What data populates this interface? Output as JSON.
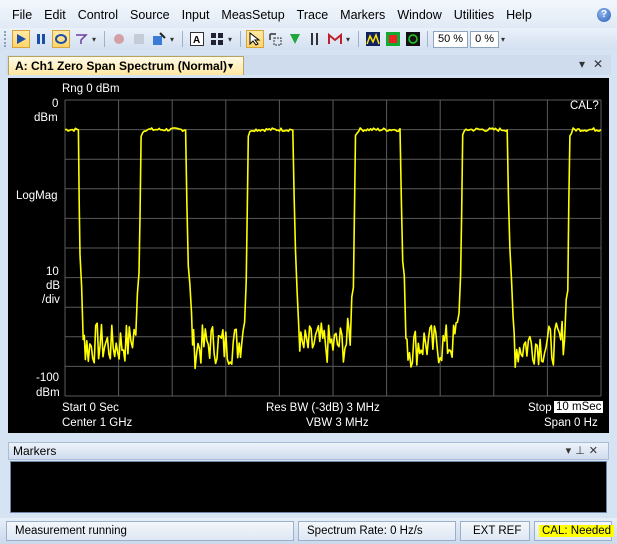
{
  "menu": [
    "File",
    "Edit",
    "Control",
    "Source",
    "Input",
    "MeasSetup",
    "Trace",
    "Markers",
    "Window",
    "Utilities",
    "Help"
  ],
  "toolbar": {
    "zoom_pct": "50 %",
    "pct2": "0 %"
  },
  "document_tab": {
    "title": "A: Ch1 Zero Span Spectrum (Normal)"
  },
  "display": {
    "range_label": "Rng 0 dBm",
    "cal_flag": "CAL?",
    "y_top_value": "0",
    "y_top_unit": "dBm",
    "y_mode": "LogMag",
    "y_div_value": "10",
    "y_div_unit1": "dB",
    "y_div_unit2": "/div",
    "y_bottom_value": "-100",
    "y_bottom_unit": "dBm",
    "start": "Start 0  Sec",
    "center": "Center 1 GHz",
    "res_bw": "Res BW (-3dB) 3 MHz",
    "vbw": "VBW 3 MHz",
    "stop_label": "Stop",
    "stop_value": "10 mSec",
    "span": "Span 0  Hz",
    "trace_color": "#ffff00",
    "grid_color": "#5a5a5a"
  },
  "chart_data": {
    "type": "line",
    "x_unit": "mSec",
    "y_unit": "dBm",
    "xlim": [
      0,
      10
    ],
    "ylim": [
      -100,
      0
    ],
    "grid": true,
    "series": [
      {
        "segments": [
          [
            0.0,
            -10
          ],
          [
            0.25,
            -10
          ],
          [
            0.28,
            -55
          ],
          [
            0.34,
            -75
          ],
          [
            0.38,
            -84
          ],
          [
            0.6,
            -82
          ],
          [
            0.9,
            -83
          ],
          [
            1.2,
            -82
          ],
          [
            1.32,
            -78
          ],
          [
            1.38,
            -60
          ],
          [
            1.42,
            -12
          ],
          [
            1.48,
            -10
          ],
          [
            2.25,
            -10
          ],
          [
            2.3,
            -55
          ],
          [
            2.36,
            -75
          ],
          [
            2.4,
            -84
          ],
          [
            2.7,
            -82
          ],
          [
            3.0,
            -83
          ],
          [
            3.25,
            -82
          ],
          [
            3.32,
            -78
          ],
          [
            3.38,
            -60
          ],
          [
            3.42,
            -12
          ],
          [
            3.48,
            -10
          ],
          [
            4.25,
            -10
          ],
          [
            4.3,
            -55
          ],
          [
            4.36,
            -75
          ],
          [
            4.4,
            -84
          ],
          [
            4.7,
            -82
          ],
          [
            5.0,
            -83
          ],
          [
            5.25,
            -82
          ],
          [
            5.32,
            -78
          ],
          [
            5.38,
            -60
          ],
          [
            5.42,
            -12
          ],
          [
            5.48,
            -10
          ],
          [
            6.25,
            -10
          ],
          [
            6.3,
            -55
          ],
          [
            6.36,
            -75
          ],
          [
            6.4,
            -84
          ],
          [
            6.7,
            -82
          ],
          [
            7.0,
            -83
          ],
          [
            7.25,
            -82
          ],
          [
            7.32,
            -78
          ],
          [
            7.38,
            -60
          ],
          [
            7.42,
            -12
          ],
          [
            7.48,
            -10
          ],
          [
            8.25,
            -10
          ],
          [
            8.3,
            -55
          ],
          [
            8.36,
            -75
          ],
          [
            8.4,
            -84
          ],
          [
            8.7,
            -82
          ],
          [
            9.0,
            -83
          ],
          [
            9.25,
            -82
          ],
          [
            9.32,
            -78
          ],
          [
            9.38,
            -60
          ],
          [
            9.42,
            -12
          ],
          [
            9.48,
            -10
          ],
          [
            10.0,
            -10
          ]
        ]
      }
    ]
  },
  "markers_panel": {
    "title": "Markers"
  },
  "status": {
    "running": "Measurement running",
    "spectrum_rate": "Spectrum Rate: 0 Hz/s",
    "ext_ref": "EXT REF",
    "cal": "CAL: Needed"
  }
}
